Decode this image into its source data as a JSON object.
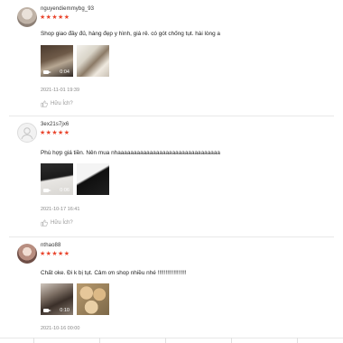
{
  "reviews": [
    {
      "username": "nguyendiemmybg_93",
      "stars": "★★★★★",
      "comment": "Shop giao đầy đủ, hàng đẹp y hình, giá rẻ. có gót chống tụt. hài lòng a",
      "media": [
        {
          "type": "video",
          "duration": "0:04"
        },
        {
          "type": "image"
        }
      ],
      "date": "2021-11-01 19:39",
      "helpful_label": "Hữu Ích?"
    },
    {
      "username": "3ex21s7jx6",
      "stars": "★★★★★",
      "comment": "Phù hợp giá tiền. Nên mua nhaaaaaaaaaaaaaaaaaaaaaaaaaaaaaaaa",
      "media": [
        {
          "type": "video",
          "duration": "0:06"
        },
        {
          "type": "image"
        }
      ],
      "date": "2021-10-17 16:41",
      "helpful_label": "Hữu Ích?"
    },
    {
      "username": "nthao88",
      "stars": "★★★★★",
      "comment": "Chất oke. Đi k bị tụt. Cảm ơn shop nhiều nhé !!!!!!!!!!!!!!!!!!",
      "media": [
        {
          "type": "video",
          "duration": "0:10"
        },
        {
          "type": "image"
        }
      ],
      "date": "2021-10-16 00:00"
    }
  ],
  "colors": {
    "star": "#e9442c",
    "muted_text": "#888888"
  },
  "icons": {
    "helpful": "thumbs-up-icon",
    "video": "video-camera-icon",
    "avatar_default": "user-icon"
  }
}
